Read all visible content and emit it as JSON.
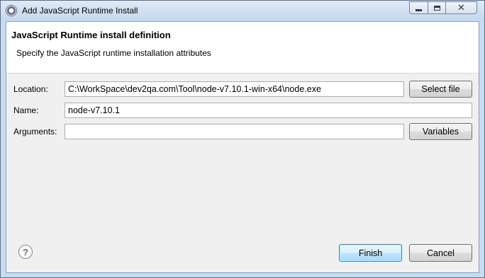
{
  "window": {
    "title": "Add JavaScript Runtime Install"
  },
  "header": {
    "title": "JavaScript Runtime install definition",
    "description": "Specify the JavaScript runtime installation attributes"
  },
  "form": {
    "location": {
      "label": "Location:",
      "value": "C:\\WorkSpace\\dev2qa.com\\Tool\\node-v7.10.1-win-x64\\node.exe",
      "button_label": "Select file"
    },
    "name": {
      "label": "Name:",
      "value": "node-v7.10.1"
    },
    "arguments": {
      "label": "Arguments:",
      "value": "",
      "button_label": "Variables"
    }
  },
  "footer": {
    "help_glyph": "?",
    "finish_label": "Finish",
    "cancel_label": "Cancel"
  },
  "icons": {
    "app": "eclipse-icon",
    "help": "help-icon",
    "minimize": "minimize-icon",
    "maximize": "maximize-icon",
    "close": "close-icon"
  },
  "colors": {
    "title_bar": "#c9dcef",
    "default_button": "#bee6fd",
    "dialog_background": "#f0f0f0"
  }
}
